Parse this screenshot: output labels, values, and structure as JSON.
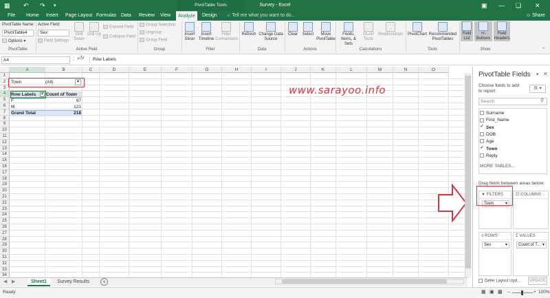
{
  "window": {
    "title": "Survey - Excel",
    "pivot_tools": "PivotTable Tools",
    "share": "Share",
    "tell_me": "Tell me what you want to do..."
  },
  "tabs": [
    "File",
    "Home",
    "Insert",
    "Page Layout",
    "Formulas",
    "Data",
    "Review",
    "View",
    "Analyze",
    "Design"
  ],
  "ribbon": {
    "pivot_name_label": "PivotTable Name:",
    "pivot_name": "PivotTable4",
    "options": "Options",
    "active_field_label": "Active Field:",
    "active_field": "Sex",
    "field_settings": "Field Settings",
    "drill_down": "Drill Down",
    "drill_up": "Drill Up",
    "expand_field": "Expand Field",
    "collapse_field": "Collapse Field",
    "group_selection": "Group Selection",
    "ungroup": "Ungroup",
    "group_field": "Group Field",
    "insert_slicer": "Insert Slicer",
    "insert_timeline": "Insert Timeline",
    "filter_connections": "Filter Connections",
    "refresh": "Refresh",
    "change_data_source": "Change Data Source",
    "clear": "Clear",
    "select": "Select",
    "move_pivottable": "Move PivotTable",
    "fields_items_sets": "Fields, Items, & Sets",
    "olap_tools": "OLAP Tools",
    "relationships": "Relationships",
    "pivotchart": "PivotChart",
    "recommended": "Recommended PivotTables",
    "field_list": "Field List",
    "buttons": "+/- Buttons",
    "field_headers": "Field Headers",
    "groups": [
      "PivotTable",
      "Active Field",
      "Group",
      "Filter",
      "Data",
      "Actions",
      "Calculations",
      "Tools",
      "Show"
    ]
  },
  "formula_bar": {
    "name_box": "A4",
    "content": "Row Labels"
  },
  "columns": [
    "A",
    "B",
    "C",
    "D",
    "E",
    "F",
    "G",
    "H",
    "I",
    "J",
    "K",
    "L",
    "M",
    "N",
    "O"
  ],
  "rows": [
    "1",
    "2",
    "3",
    "4",
    "5",
    "6",
    "7",
    "8",
    "9",
    "10",
    "11",
    "12",
    "13",
    "14",
    "15",
    "16",
    "17",
    "18",
    "19",
    "20",
    "21",
    "22",
    "23",
    "24",
    "25",
    "26",
    "27",
    "28",
    "29",
    "30",
    "31",
    "32",
    "33",
    "34"
  ],
  "pivot": {
    "filter_field": "Town",
    "filter_value": "(All)",
    "header_row_labels": "Row Labels",
    "header_count": "Count of Town",
    "rows": [
      {
        "label": "F",
        "value": "97"
      },
      {
        "label": "M",
        "value": "121"
      }
    ],
    "grand_total_label": "Grand Total",
    "grand_total": "218"
  },
  "watermark": "www.sarayoo.info",
  "sheets": [
    "Sheet1",
    "Survey Results"
  ],
  "status": {
    "ready": "Ready",
    "zoom": "100%"
  },
  "pane": {
    "title": "PivotTable Fields",
    "subtitle": "Choose fields to add to report:",
    "search_placeholder": "Search",
    "fields": [
      {
        "name": "Surname",
        "checked": false
      },
      {
        "name": "First_Name",
        "checked": false
      },
      {
        "name": "Sex",
        "checked": true
      },
      {
        "name": "DOB",
        "checked": false
      },
      {
        "name": "Age",
        "checked": false
      },
      {
        "name": "Town",
        "checked": true
      },
      {
        "name": "Reply",
        "checked": false
      }
    ],
    "more_tables": "MORE TABLES...",
    "drag_text": "Drag fields between areas below:",
    "filters_label": "FILTERS",
    "columns_label": "COLUMNS",
    "rows_label": "ROWS",
    "values_label": "VALUES",
    "filters_item": "Town",
    "rows_item": "Sex",
    "values_item": "Count of T...",
    "defer_label": "Defer Layout Upd...",
    "update": "UPDATE"
  },
  "colors": {
    "excel_green": "#217346",
    "highlight_red": "#d9363e",
    "header_blue": "#dce6f1"
  }
}
